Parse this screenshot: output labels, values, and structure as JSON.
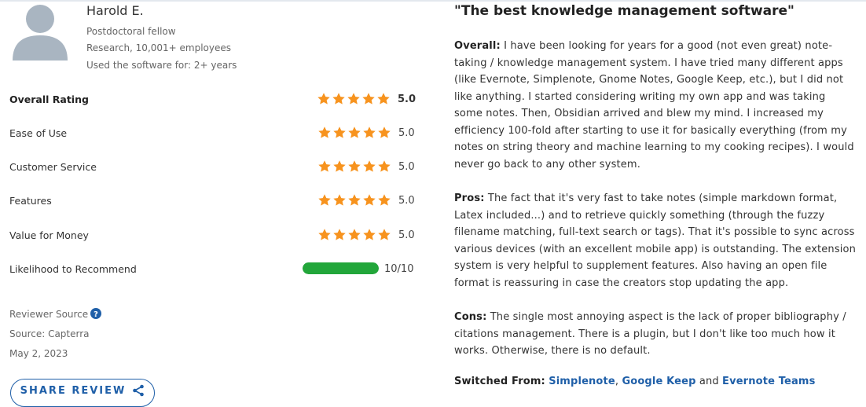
{
  "reviewer": {
    "name": "Harold E.",
    "role": "Postdoctoral fellow",
    "company": "Research, 10,001+ employees",
    "usage": "Used the software for: 2+ years"
  },
  "ratings": [
    {
      "label": "Overall Rating",
      "value": "5.0",
      "stars": 5
    },
    {
      "label": "Ease of Use",
      "value": "5.0",
      "stars": 5
    },
    {
      "label": "Customer Service",
      "value": "5.0",
      "stars": 5
    },
    {
      "label": "Features",
      "value": "5.0",
      "stars": 5
    },
    {
      "label": "Value for Money",
      "value": "5.0",
      "stars": 5
    }
  ],
  "likelihood": {
    "label": "Likelihood to Recommend",
    "value": "10/10",
    "fraction": 1.0
  },
  "source": {
    "reviewer_source_label": "Reviewer Source",
    "source_line": "Source: Capterra",
    "date": "May 2, 2023"
  },
  "share_button": "SHARE REVIEW",
  "review": {
    "title": "\"The best knowledge management software\"",
    "overall_label": "Overall:",
    "overall_text": "I have been looking for years for a good (not even great) note-taking / knowledge management system. I have tried many different apps (like Evernote, Simplenote, Gnome Notes, Google Keep, etc.), but I did not like anything. I started considering writing my own app and was taking some notes. Then, Obsidian arrived and blew my mind. I increased my efficiency 100-fold after starting to use it for basically everything (from my notes on string theory and machine learning to my cooking recipes). I would never go back to any other system.",
    "pros_label": "Pros:",
    "pros_text": "The fact that it's very fast to take notes (simple markdown format, Latex included...) and to retrieve quickly something (through the fuzzy filename matching, full-text search or tags). That it's possible to sync across various devices (with an excellent mobile app) is outstanding. The extension system is very helpful to supplement features. Also having an open file format is reassuring in case the creators stop updating the app.",
    "cons_label": "Cons:",
    "cons_text": "The single most annoying aspect is the lack of proper bibliography / citations management. There is a plugin, but I don't like too much how it works. Otherwise, there is no default.",
    "switched_label": "Switched From:",
    "switched_from": [
      "Simplenote",
      "Google Keep",
      "Evernote Teams"
    ],
    "switched_sep1": ",",
    "switched_and": "and"
  },
  "colors": {
    "star": "#f7931e",
    "link": "#1f5fa8",
    "bar_fill": "#22a63a",
    "avatar": "#a9b5c1"
  }
}
